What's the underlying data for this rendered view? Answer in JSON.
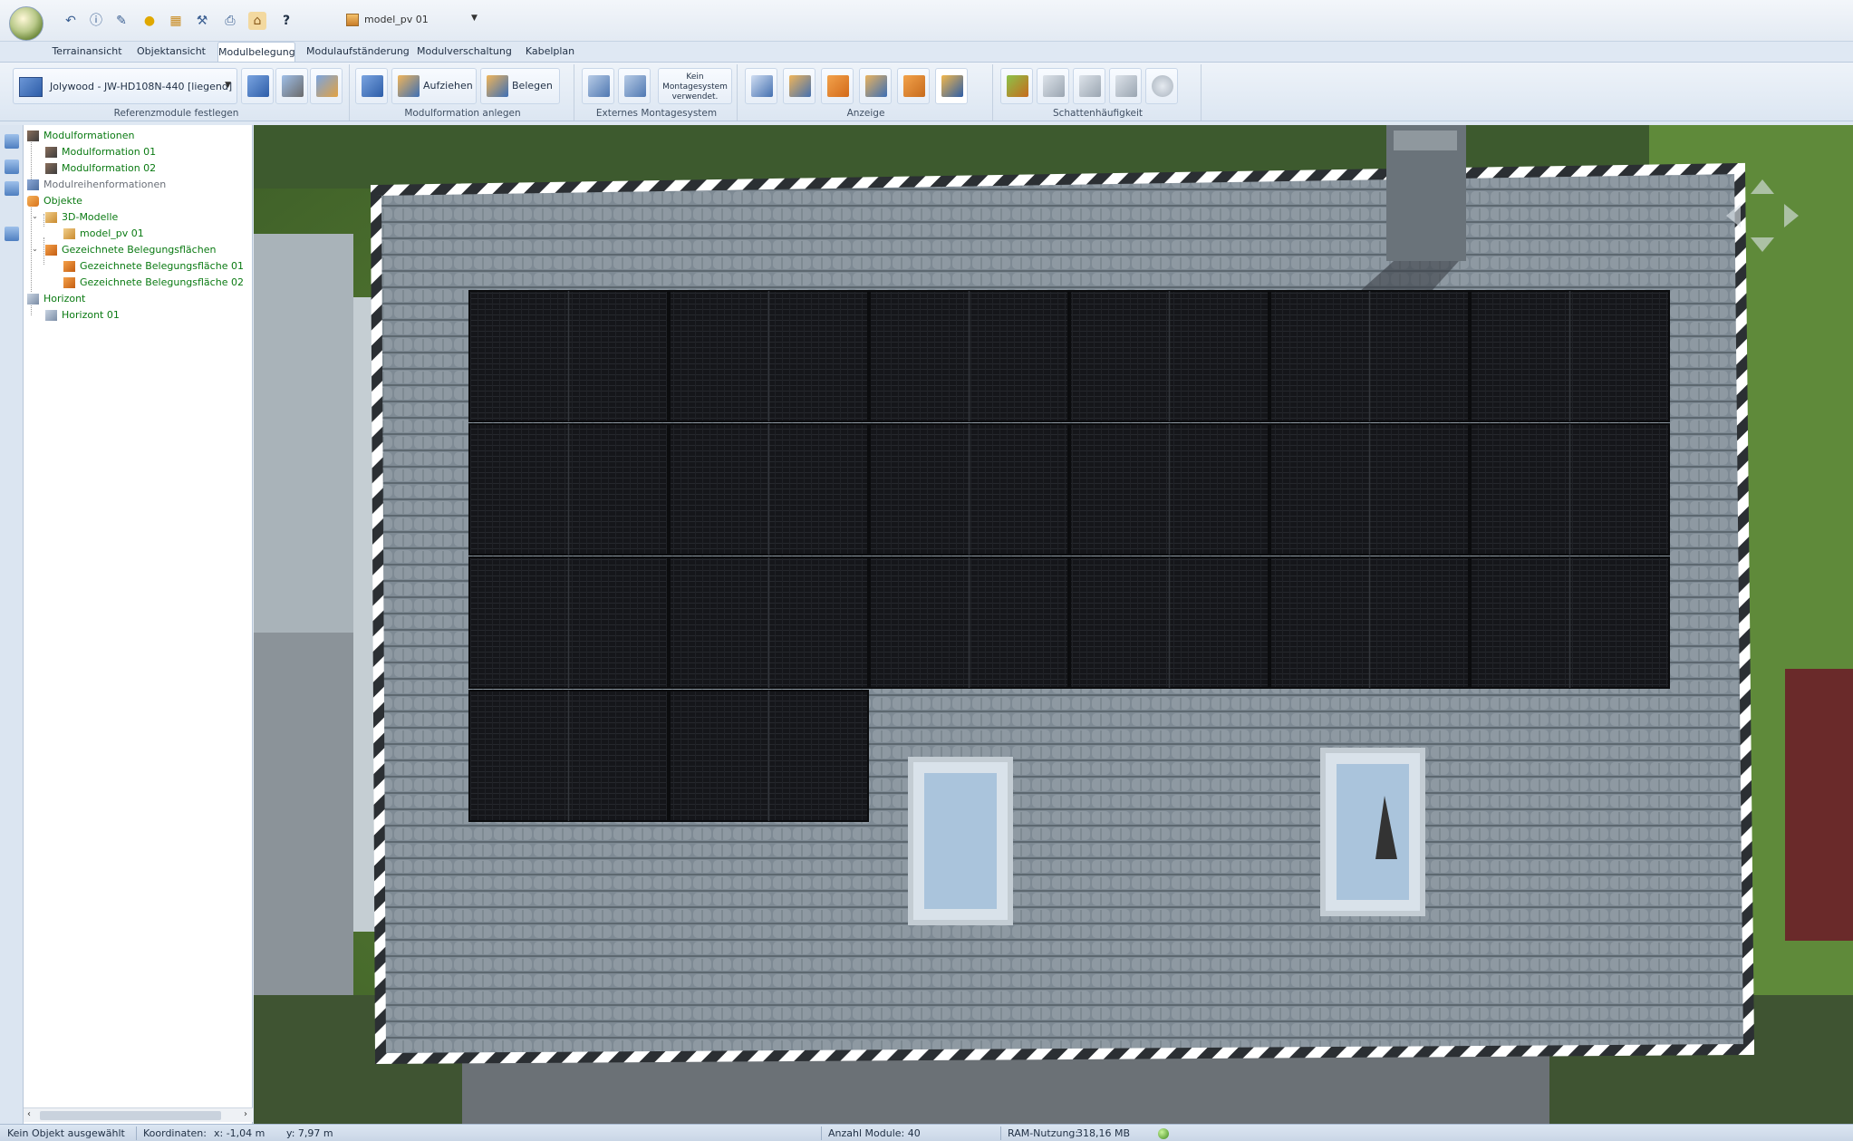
{
  "window": {
    "document_name": "model_pv 01"
  },
  "tabs": [
    "Terrainansicht",
    "Objektansicht",
    "Modulbelegung",
    "Modulaufständerung",
    "Modulverschaltung",
    "Kabelplan"
  ],
  "active_tab": "Modulbelegung",
  "ribbon": {
    "groups": [
      "Referenzmodule festlegen",
      "Modulformation anlegen",
      "Externes Montagesystem",
      "Anzeige",
      "Schattenhäufigkeit"
    ],
    "reference_module": "Jolywood - JW-HD108N-440 [liegend]",
    "aufziehen_label": "Aufziehen",
    "belegen_label": "Belegen",
    "montage_status": "Kein Montagesystem verwendet."
  },
  "tree": {
    "modulformationen": "Modulformationen",
    "modulformation_01": "Modulformation 01",
    "modulformation_02": "Modulformation 02",
    "modulreihenformationen": "Modulreihenformationen",
    "objekte": "Objekte",
    "modelle_3d": "3D-Modelle",
    "model_pv": "model_pv 01",
    "flaechen": "Gezeichnete Belegungsflächen",
    "flaeche_01": "Gezeichnete Belegungsfläche 01",
    "flaeche_02": "Gezeichnete Belegungsfläche 02",
    "horizont": "Horizont",
    "horizont_01": "Horizont 01"
  },
  "statusbar": {
    "selection": "Kein Objekt ausgewählt",
    "koordinaten_label": "Koordinaten:",
    "x": "x: -1,04 m",
    "y": "y: 7,97 m",
    "anzahl_module": "Anzahl Module: 40",
    "ram_label": "RAM-Nutzung:",
    "ram_value": "318,16 MB"
  },
  "panel_layout": {
    "rows_full": 3,
    "cols": 6,
    "last_row_modules": 2
  },
  "colors": {
    "accent": "#3b6fb6",
    "tree_text": "#0a7a12",
    "panel": "#121316",
    "roof": "#7f8b95"
  }
}
